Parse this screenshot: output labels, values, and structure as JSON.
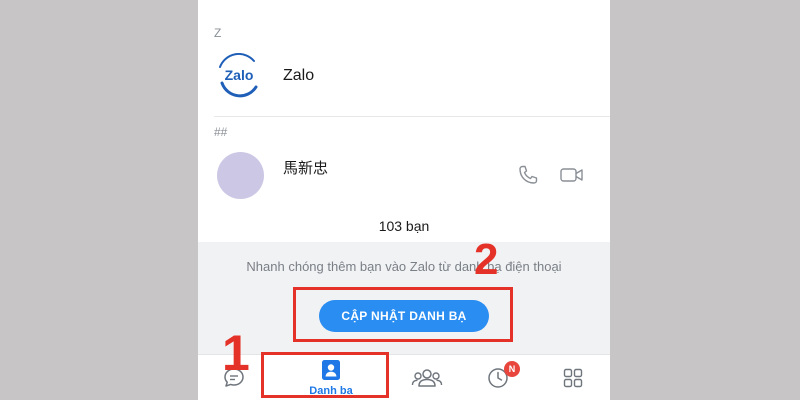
{
  "contacts": {
    "sections": [
      {
        "header": "Z",
        "items": [
          {
            "name": "Zalo",
            "icon": "zalo-logo-icon"
          }
        ]
      },
      {
        "header": "##",
        "items": [
          {
            "name": "馬新忠",
            "icon": "avatar"
          }
        ]
      }
    ],
    "friend_count": "103 bạn"
  },
  "sync": {
    "description": "Nhanh chóng thêm bạn vào Zalo từ danh bạ điện thoại",
    "button_label": "CẬP NHẬT DANH BẠ"
  },
  "logo_text": "Zalo",
  "bottom_nav": {
    "items": [
      {
        "icon": "chat-bubble-icon",
        "label": ""
      },
      {
        "icon": "contact-book-icon",
        "label": "Danh bạ",
        "active": true
      },
      {
        "icon": "groups-icon",
        "label": ""
      },
      {
        "icon": "clock-icon",
        "label": "",
        "badge": "N"
      },
      {
        "icon": "grid-apps-icon",
        "label": ""
      }
    ]
  },
  "annotations": {
    "step1": "1",
    "step2": "2"
  },
  "colors": {
    "accent": "#2a8df2",
    "nav_active": "#1f78e6",
    "highlight": "#e53228",
    "badge": "#e8453c",
    "background": "#c8c5c6"
  }
}
